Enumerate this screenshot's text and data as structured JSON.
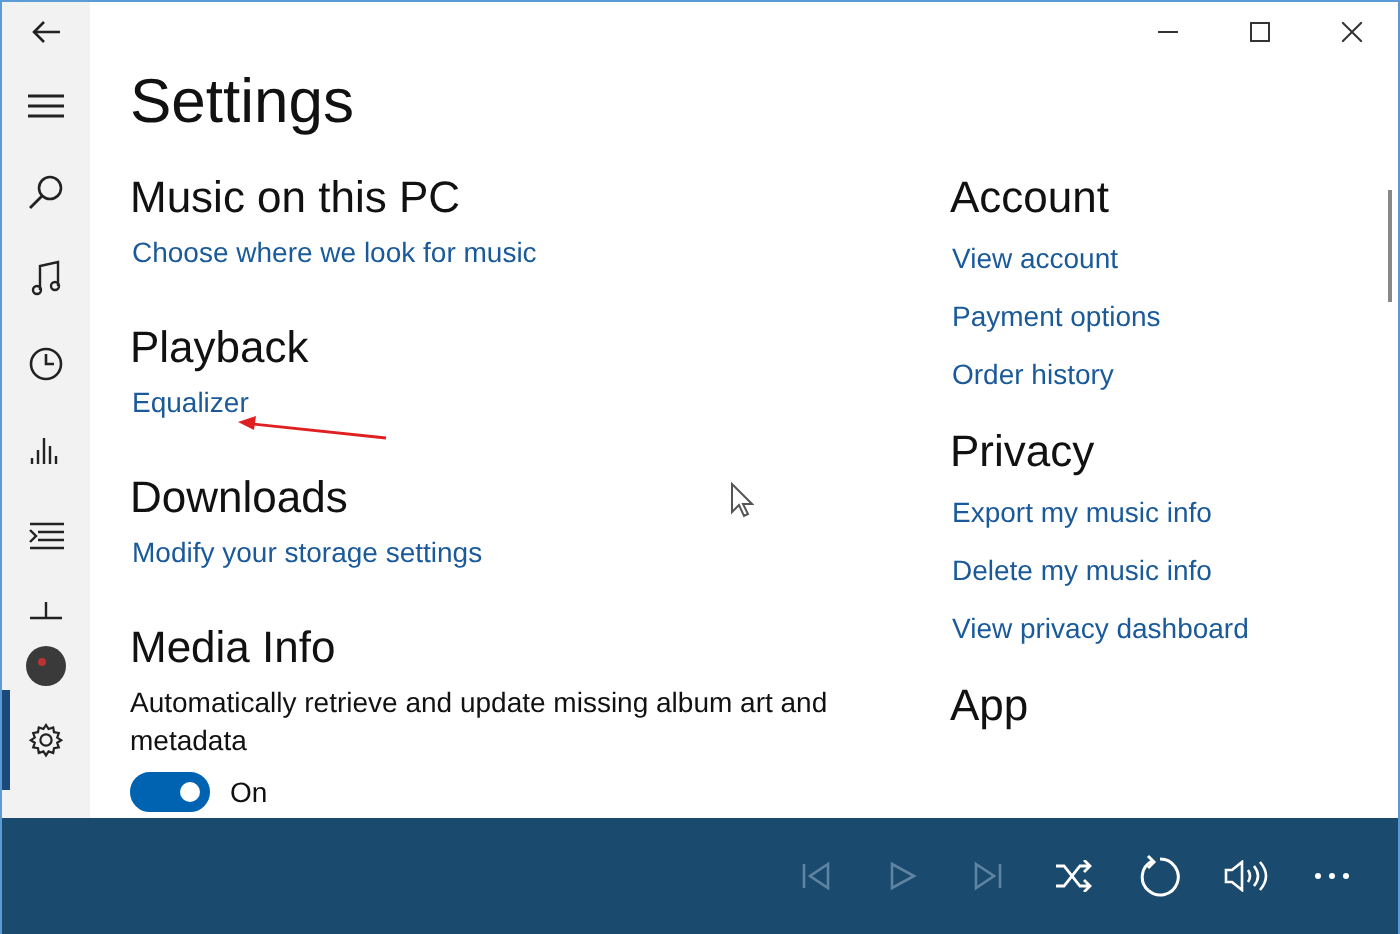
{
  "window": {
    "controls": [
      {
        "kind": "minimize"
      },
      {
        "kind": "maximize"
      },
      {
        "kind": "close"
      }
    ]
  },
  "sidebar": {
    "items": [
      {
        "kind": "back",
        "selected": false
      },
      {
        "kind": "menu",
        "selected": false
      },
      {
        "kind": "search",
        "selected": false
      },
      {
        "kind": "music",
        "selected": false
      },
      {
        "kind": "recent",
        "selected": false
      },
      {
        "kind": "charts",
        "selected": false
      },
      {
        "kind": "now-playing",
        "selected": false
      },
      {
        "kind": "add",
        "selected": false
      },
      {
        "kind": "avatar",
        "selected": false
      },
      {
        "kind": "settings",
        "selected": true
      }
    ]
  },
  "page": {
    "title": "Settings"
  },
  "left_sections": [
    {
      "heading": "Music on this PC",
      "links": [
        "Choose where we look for music"
      ]
    },
    {
      "heading": "Playback",
      "links": [
        "Equalizer"
      ]
    },
    {
      "heading": "Downloads",
      "links": [
        "Modify your storage settings"
      ]
    },
    {
      "heading": "Media Info",
      "description": "Automatically retrieve and update missing album art and metadata",
      "toggle": {
        "on": true,
        "label": "On"
      }
    }
  ],
  "right_sections": [
    {
      "heading": "Account",
      "links": [
        "View account",
        "Payment options",
        "Order history"
      ]
    },
    {
      "heading": "Privacy",
      "links": [
        "Export my music info",
        "Delete my music info",
        "View privacy dashboard"
      ]
    },
    {
      "heading": "App"
    }
  ],
  "player": {
    "controls": [
      {
        "kind": "previous",
        "disabled": true
      },
      {
        "kind": "play",
        "disabled": true
      },
      {
        "kind": "next",
        "disabled": true
      },
      {
        "kind": "shuffle",
        "disabled": false
      },
      {
        "kind": "repeat",
        "disabled": false
      },
      {
        "kind": "volume",
        "disabled": false
      },
      {
        "kind": "more",
        "disabled": false
      }
    ]
  }
}
